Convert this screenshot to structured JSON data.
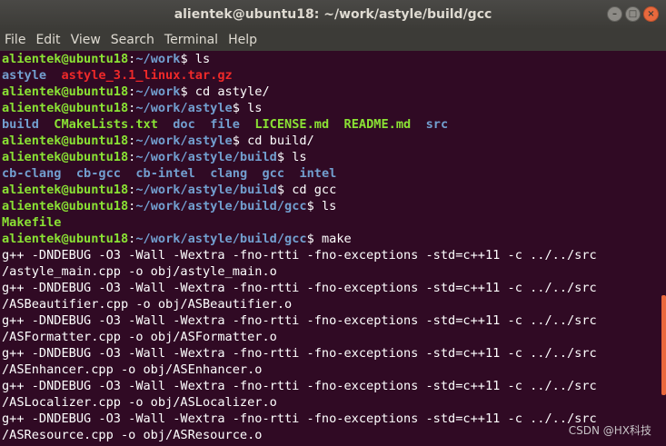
{
  "window": {
    "title": "alientek@ubuntu18: ~/work/astyle/build/gcc",
    "minimize_glyph": "–",
    "maximize_glyph": "□",
    "close_glyph": "×"
  },
  "menu": [
    "File",
    "Edit",
    "View",
    "Search",
    "Terminal",
    "Help"
  ],
  "colors": {
    "background": "#300a24",
    "prompt_user": "#8ae234",
    "prompt_path": "#729fcf",
    "directory": "#729fcf",
    "archive": "#ef2929",
    "executable": "#8ae234",
    "text": "#ffffff",
    "scrollbar": "#e9693d"
  },
  "terminal": {
    "user_host": "alientek@ubuntu18",
    "lines": [
      [
        {
          "t": "alientek@ubuntu18",
          "c": "user"
        },
        {
          "t": ":"
        },
        {
          "t": "~/work",
          "c": "path"
        },
        {
          "t": "$ ls"
        }
      ],
      [
        {
          "t": "astyle",
          "c": "dir"
        },
        {
          "t": "  "
        },
        {
          "t": "astyle_3.1_linux.tar.gz",
          "c": "archive"
        }
      ],
      [
        {
          "t": "alientek@ubuntu18",
          "c": "user"
        },
        {
          "t": ":"
        },
        {
          "t": "~/work",
          "c": "path"
        },
        {
          "t": "$ cd astyle/"
        }
      ],
      [
        {
          "t": "alientek@ubuntu18",
          "c": "user"
        },
        {
          "t": ":"
        },
        {
          "t": "~/work/astyle",
          "c": "path"
        },
        {
          "t": "$ ls"
        }
      ],
      [
        {
          "t": "build",
          "c": "dir"
        },
        {
          "t": "  "
        },
        {
          "t": "CMakeLists.txt",
          "c": "exe"
        },
        {
          "t": "  "
        },
        {
          "t": "doc",
          "c": "dir"
        },
        {
          "t": "  "
        },
        {
          "t": "file",
          "c": "dir"
        },
        {
          "t": "  "
        },
        {
          "t": "LICENSE.md",
          "c": "exe"
        },
        {
          "t": "  "
        },
        {
          "t": "README.md",
          "c": "exe"
        },
        {
          "t": "  "
        },
        {
          "t": "src",
          "c": "dir"
        }
      ],
      [
        {
          "t": "alientek@ubuntu18",
          "c": "user"
        },
        {
          "t": ":"
        },
        {
          "t": "~/work/astyle",
          "c": "path"
        },
        {
          "t": "$ cd build/"
        }
      ],
      [
        {
          "t": "alientek@ubuntu18",
          "c": "user"
        },
        {
          "t": ":"
        },
        {
          "t": "~/work/astyle/build",
          "c": "path"
        },
        {
          "t": "$ ls"
        }
      ],
      [
        {
          "t": "cb-clang",
          "c": "dir"
        },
        {
          "t": "  "
        },
        {
          "t": "cb-gcc",
          "c": "dir"
        },
        {
          "t": "  "
        },
        {
          "t": "cb-intel",
          "c": "dir"
        },
        {
          "t": "  "
        },
        {
          "t": "clang",
          "c": "dir"
        },
        {
          "t": "  "
        },
        {
          "t": "gcc",
          "c": "dir"
        },
        {
          "t": "  "
        },
        {
          "t": "intel",
          "c": "dir"
        }
      ],
      [
        {
          "t": "alientek@ubuntu18",
          "c": "user"
        },
        {
          "t": ":"
        },
        {
          "t": "~/work/astyle/build",
          "c": "path"
        },
        {
          "t": "$ cd gcc"
        }
      ],
      [
        {
          "t": "alientek@ubuntu18",
          "c": "user"
        },
        {
          "t": ":"
        },
        {
          "t": "~/work/astyle/build/gcc",
          "c": "path"
        },
        {
          "t": "$ ls"
        }
      ],
      [
        {
          "t": "Makefile",
          "c": "exe"
        }
      ],
      [
        {
          "t": "alientek@ubuntu18",
          "c": "user"
        },
        {
          "t": ":"
        },
        {
          "t": "~/work/astyle/build/gcc",
          "c": "path"
        },
        {
          "t": "$ make"
        }
      ],
      [
        {
          "t": "g++ -DNDEBUG -O3 -Wall -Wextra -fno-rtti -fno-exceptions -std=c++11 -c ../../src"
        }
      ],
      [
        {
          "t": "/astyle_main.cpp -o obj/astyle_main.o"
        }
      ],
      [
        {
          "t": "g++ -DNDEBUG -O3 -Wall -Wextra -fno-rtti -fno-exceptions -std=c++11 -c ../../src"
        }
      ],
      [
        {
          "t": "/ASBeautifier.cpp -o obj/ASBeautifier.o"
        }
      ],
      [
        {
          "t": "g++ -DNDEBUG -O3 -Wall -Wextra -fno-rtti -fno-exceptions -std=c++11 -c ../../src"
        }
      ],
      [
        {
          "t": "/ASFormatter.cpp -o obj/ASFormatter.o"
        }
      ],
      [
        {
          "t": "g++ -DNDEBUG -O3 -Wall -Wextra -fno-rtti -fno-exceptions -std=c++11 -c ../../src"
        }
      ],
      [
        {
          "t": "/ASEnhancer.cpp -o obj/ASEnhancer.o"
        }
      ],
      [
        {
          "t": "g++ -DNDEBUG -O3 -Wall -Wextra -fno-rtti -fno-exceptions -std=c++11 -c ../../src"
        }
      ],
      [
        {
          "t": "/ASLocalizer.cpp -o obj/ASLocalizer.o"
        }
      ],
      [
        {
          "t": "g++ -DNDEBUG -O3 -Wall -Wextra -fno-rtti -fno-exceptions -std=c++11 -c ../../src"
        }
      ],
      [
        {
          "t": "/ASResource.cpp -o obj/ASResource.o"
        }
      ]
    ]
  },
  "watermark": "CSDN @HX科技"
}
